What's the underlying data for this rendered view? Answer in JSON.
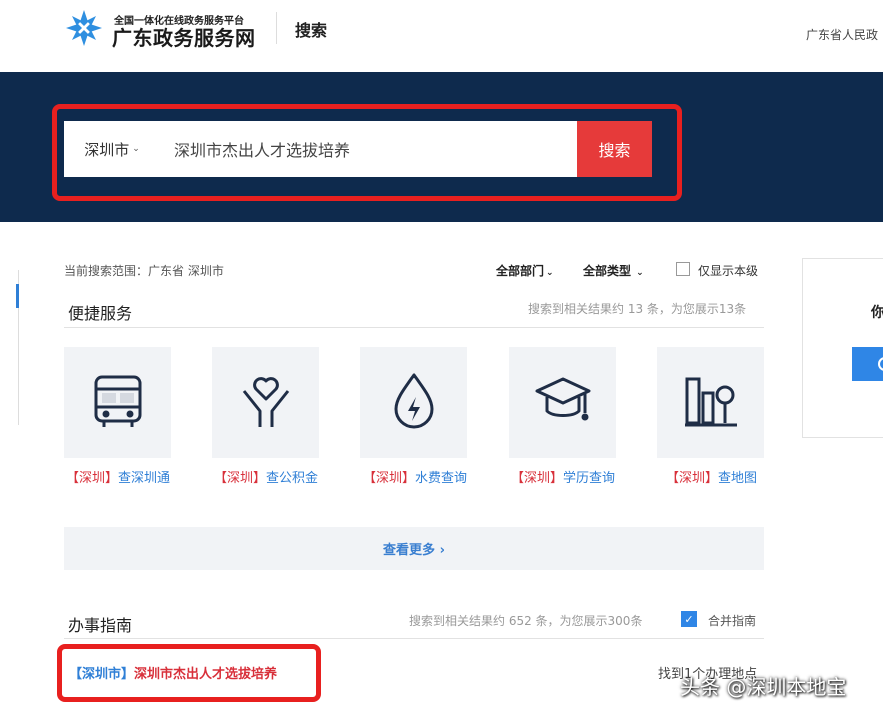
{
  "header": {
    "logo_subtitle": "全国一体化在线政务服务平台",
    "logo_title": "广东政务服务网",
    "page_title": "搜索",
    "right_text": "广东省人民政"
  },
  "search": {
    "city": "深圳市",
    "query": "深圳市杰出人才选拔培养",
    "button_label": "搜索"
  },
  "filters": {
    "scope": "当前搜索范围：广东省 深圳市",
    "department": "全部部门",
    "type": "全部类型",
    "local_only_label": "仅显示本级",
    "local_only_checked": false
  },
  "side_card": {
    "text": "你"
  },
  "quick_services": {
    "title": "便捷服务",
    "info": "搜索到相关结果约 13 条，为您展示13条",
    "items": [
      {
        "tag": "【深圳】",
        "name": "查深圳通",
        "icon": "bus-icon"
      },
      {
        "tag": "【深圳】",
        "name": "查公积金",
        "icon": "heart-hands-icon"
      },
      {
        "tag": "【深圳】",
        "name": "水费查询",
        "icon": "water-drop-icon"
      },
      {
        "tag": "【深圳】",
        "name": "学历查询",
        "icon": "graduation-cap-icon"
      },
      {
        "tag": "【深圳】",
        "name": "查地图",
        "icon": "city-map-icon"
      }
    ],
    "more_label": "查看更多 ›"
  },
  "guide": {
    "title": "办事指南",
    "info": "搜索到相关结果约 652 条，为您展示300条",
    "merge_label": "合并指南",
    "merge_checked": true,
    "result_tag": "【深圳市】",
    "result_name": "深圳市杰出人才选拔培养",
    "found_text": "找到1个办理地点"
  },
  "watermark": "头条 @深圳本地宝",
  "colors": {
    "banner_navy": "#0e2a4d",
    "search_red": "#e63a3a",
    "highlight_red": "#e8201f",
    "link_blue": "#2f7fd6",
    "tag_red": "#d8303a"
  }
}
